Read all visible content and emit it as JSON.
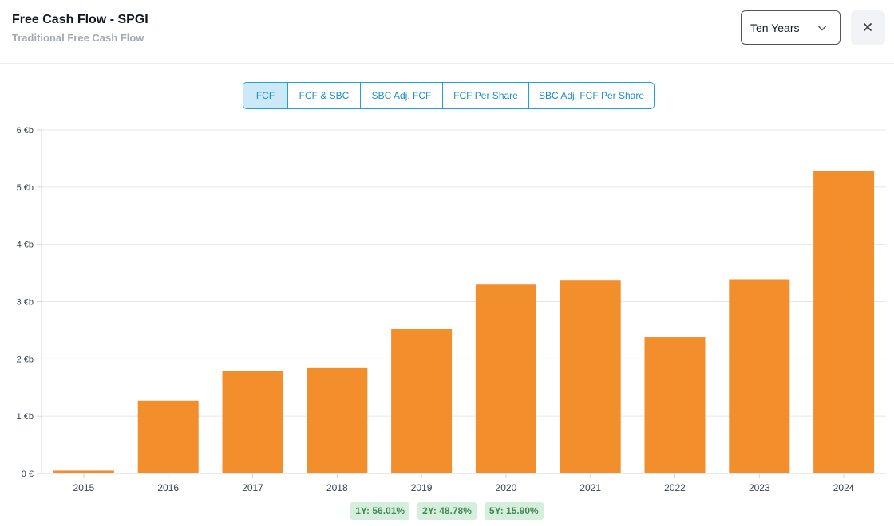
{
  "header": {
    "title": "Free Cash Flow - SPGI",
    "subtitle": "Traditional Free Cash Flow"
  },
  "period_select": {
    "value": "Ten Years"
  },
  "close_icon": "close-icon",
  "tabs": [
    {
      "label": "FCF",
      "active": true
    },
    {
      "label": "FCF & SBC",
      "active": false
    },
    {
      "label": "SBC Adj. FCF",
      "active": false
    },
    {
      "label": "FCF Per Share",
      "active": false
    },
    {
      "label": "SBC Adj. FCF Per Share",
      "active": false
    }
  ],
  "colors": {
    "bar": "#f28f2c",
    "accent": "#1fa1d6",
    "badge_bg": "#d6efdc",
    "badge_text": "#3f8a55"
  },
  "chart_data": {
    "type": "bar",
    "categories": [
      "2015",
      "2016",
      "2017",
      "2018",
      "2019",
      "2020",
      "2021",
      "2022",
      "2023",
      "2024"
    ],
    "values": [
      0.05,
      1.27,
      1.79,
      1.84,
      2.52,
      3.31,
      3.38,
      2.38,
      3.39,
      5.29
    ],
    "ylim": [
      0,
      6
    ],
    "yticks": [
      0,
      1,
      2,
      3,
      4,
      5,
      6
    ],
    "ytick_labels": [
      "0 €",
      "1 €b",
      "2 €b",
      "3 €b",
      "4 €b",
      "5 €b",
      "6 €b"
    ],
    "grid": true,
    "xlabel": "",
    "ylabel": ""
  },
  "growth": [
    {
      "label": "1Y: 56.01%"
    },
    {
      "label": "2Y: 48.78%"
    },
    {
      "label": "5Y: 15.90%"
    }
  ]
}
